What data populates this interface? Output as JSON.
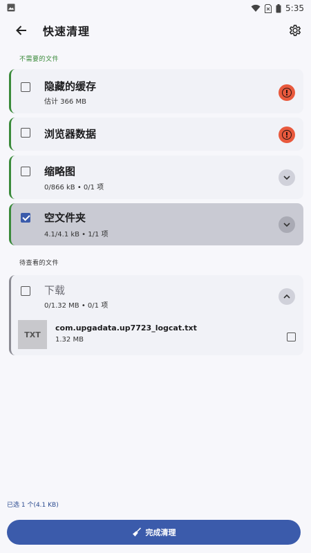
{
  "status": {
    "time": "5:35"
  },
  "app_bar": {
    "title": "快速清理"
  },
  "sections": {
    "unneeded": {
      "label": "不需要的文件",
      "color": "#3a8a3a"
    },
    "review": {
      "label": "待查看的文件",
      "color": "#333333"
    }
  },
  "cards": [
    {
      "title": "隐藏的缓存",
      "subtitle": "估计 366 MB",
      "checked": false,
      "trailing": "alert-icon"
    },
    {
      "title": "浏览器数据",
      "subtitle": "",
      "checked": false,
      "trailing": "alert-icon"
    },
    {
      "title": "缩略图",
      "subtitle": "0/866 kB • 0/1 项",
      "checked": false,
      "trailing": "chevron-down-icon"
    },
    {
      "title": "空文件夹",
      "subtitle": "4.1/4.1 kB • 1/1 项",
      "checked": true,
      "trailing": "chevron-down-icon"
    }
  ],
  "downloads": {
    "title": "下载",
    "subtitle": "0/1.32 MB • 0/1 项",
    "checked": false,
    "trailing": "chevron-up-icon",
    "file": {
      "thumb": "TXT",
      "name": "com.upgadata.up7723_logcat.txt",
      "size": "1.32 MB",
      "checked": false
    }
  },
  "footer": {
    "selection": "已选 1 个(4.1 KB)",
    "button_label": "完成清理"
  }
}
